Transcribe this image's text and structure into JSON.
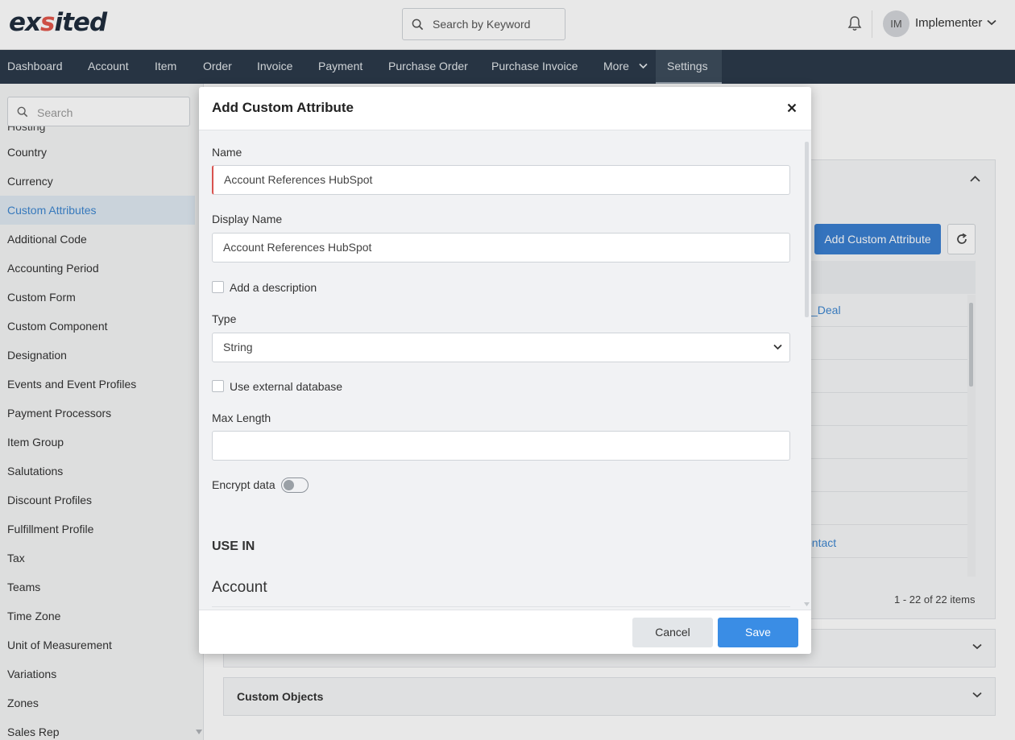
{
  "header": {
    "logo": {
      "left": "ex",
      "accent": "s",
      "right": "ited"
    },
    "search_placeholder": "Search by Keyword",
    "user_initials": "IM",
    "user_name": "Implementer"
  },
  "nav": {
    "items": [
      "Dashboard",
      "Account",
      "Item",
      "Order",
      "Invoice",
      "Payment",
      "Purchase Order",
      "Purchase Invoice",
      "More",
      "Settings"
    ],
    "active": "Settings"
  },
  "sidebar": {
    "search_placeholder": "Search",
    "partial_item": "Hosting",
    "items": [
      "Country",
      "Currency",
      "Custom Attributes",
      "Additional Code",
      "Accounting Period",
      "Custom Form",
      "Custom Component",
      "Designation",
      "Events and Event Profiles",
      "Payment Processors",
      "Item Group",
      "Salutations",
      "Discount Profiles",
      "Fulfillment Profile",
      "Tax",
      "Teams",
      "Time Zone",
      "Unit of Measurement",
      "Variations",
      "Zones",
      "Sales Rep"
    ],
    "active": "Custom Attributes"
  },
  "background": {
    "add_button": "Add Custom Attribute",
    "row_link_1": "_Deal",
    "row_link_2": "ontact",
    "pager": "1 - 22 of 22 items",
    "section_custom_objects": "Custom Objects"
  },
  "modal": {
    "title": "Add Custom Attribute",
    "name_label": "Name",
    "name_value": "Account References HubSpot",
    "display_name_label": "Display Name",
    "display_name_value": "Account References HubSpot",
    "add_description_label": "Add a description",
    "type_label": "Type",
    "type_value": "String",
    "external_db_label": "Use external database",
    "max_length_label": "Max Length",
    "max_length_value": "",
    "encrypt_label": "Encrypt data",
    "encrypt_on": false,
    "use_in_heading": "USE IN",
    "use_in_first": "Account",
    "cancel_label": "Cancel",
    "save_label": "Save"
  },
  "colors": {
    "nav_bg": "#2b3a4a",
    "accent_blue": "#3a8de5",
    "active_link": "#3d86cf",
    "error_border": "#d9534f"
  }
}
